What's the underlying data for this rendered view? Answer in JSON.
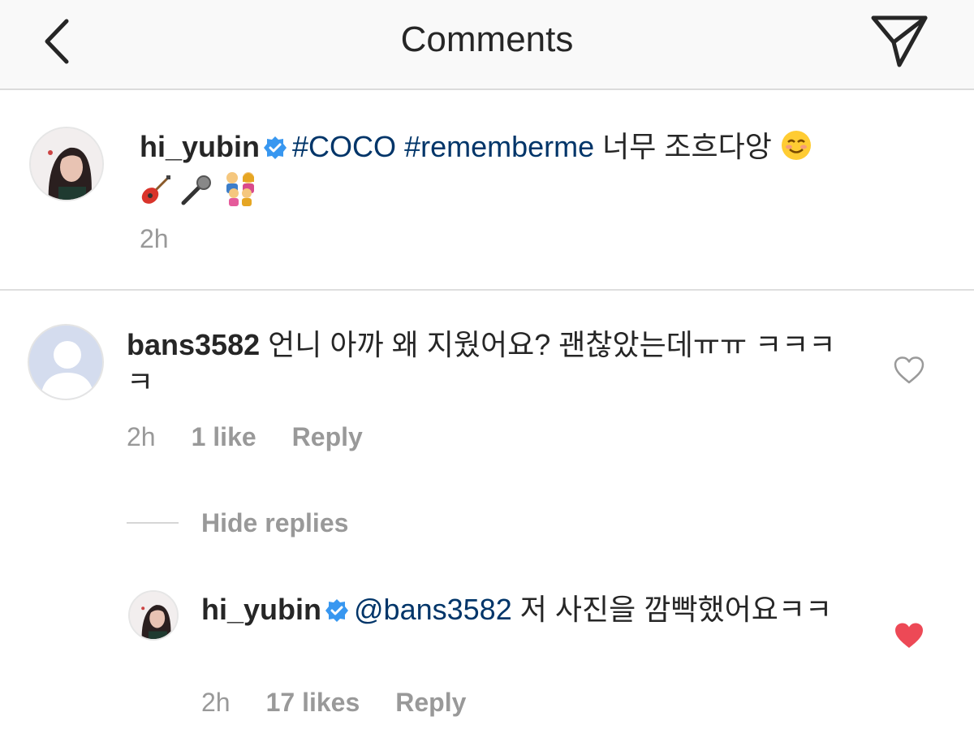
{
  "header": {
    "title": "Comments",
    "back_icon": "chevron-left-icon",
    "share_icon": "paper-plane-icon"
  },
  "caption": {
    "username": "hi_yubin",
    "verified": true,
    "hashtag1": "#COCO",
    "hashtag2": "#rememberme",
    "text": "너무 조흐다앙",
    "emojis": [
      "smiling-face-icon",
      "guitar-icon",
      "microphone-icon",
      "family-icon"
    ],
    "time": "2h"
  },
  "comments": [
    {
      "username": "bans3582",
      "text": "언니 아까 왜 지웠어요? 괜찮았는데ㅠㅠ ㅋㅋㅋㅋ",
      "time": "2h",
      "likes": "1 like",
      "reply_label": "Reply",
      "liked": false
    }
  ],
  "hide_replies_label": "Hide replies",
  "reply": {
    "username": "hi_yubin",
    "verified": true,
    "mention": "@bans3582",
    "text": "저 사진을 깜빡했어요ㅋㅋ",
    "time": "2h",
    "likes": "17 likes",
    "reply_label": "Reply",
    "liked": true
  },
  "colors": {
    "link": "#003569",
    "muted": "#999999",
    "verified_blue": "#3897f0",
    "liked_red": "#ed4956"
  }
}
